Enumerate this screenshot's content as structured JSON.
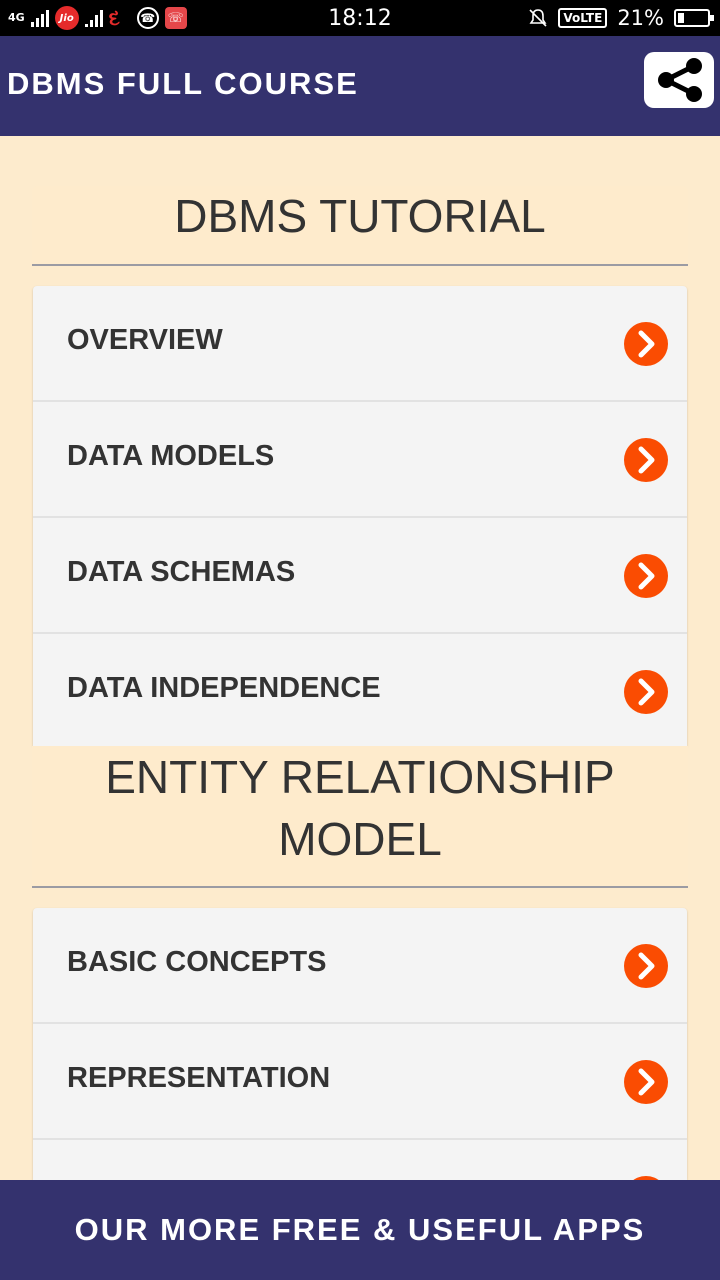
{
  "status_bar": {
    "network": "4G",
    "jio": "Jio",
    "time": "18:12",
    "volte": "VoLTE",
    "battery": "21%"
  },
  "app_bar": {
    "title": "DBMS FULL COURSE",
    "share_icon": "share-icon"
  },
  "sections": [
    {
      "title": "DBMS TUTORIAL",
      "items": [
        {
          "label": "OVERVIEW"
        },
        {
          "label": "DATA MODELS"
        },
        {
          "label": "DATA SCHEMAS"
        },
        {
          "label": "DATA INDEPENDENCE"
        }
      ]
    },
    {
      "title_line1": "ENTITY RELATIONSHIP",
      "title_line2": "MODEL",
      "items": [
        {
          "label": "BASIC CONCEPTS"
        },
        {
          "label": "REPRESENTATION"
        },
        {
          "label": ""
        }
      ]
    }
  ],
  "bottom_bar": {
    "label": "OUR MORE FREE & USEFUL APPS"
  },
  "colors": {
    "primary": "#34326E",
    "background": "#FDEBCD",
    "accent": "#FA4C02",
    "list_bg": "#F4F4F4"
  }
}
